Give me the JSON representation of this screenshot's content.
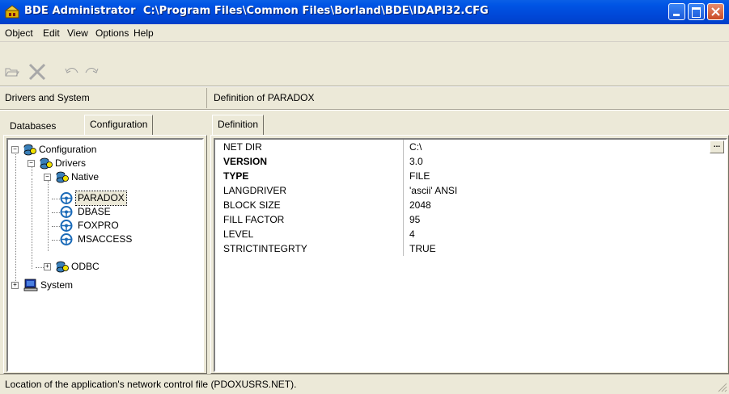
{
  "window": {
    "app": "BDE Administrator",
    "path": "C:\\Program Files\\Common Files\\Borland\\BDE\\IDAPI32.CFG"
  },
  "menu": [
    {
      "label": "Object"
    },
    {
      "label": "Edit"
    },
    {
      "label": "View"
    },
    {
      "label": "Options"
    },
    {
      "label": "Help"
    }
  ],
  "toolbar": {
    "icons": [
      "open-icon",
      "delete-icon",
      "undo-icon",
      "redo-icon"
    ]
  },
  "left_header": "Drivers and System",
  "right_header": "Definition of PARADOX",
  "left_tabs": [
    "Databases",
    "Configuration"
  ],
  "right_tabs": [
    "Definition"
  ],
  "tree": {
    "root": "Configuration",
    "drivers": "Drivers",
    "native": "Native",
    "native_items": [
      "PARADOX",
      "DBASE",
      "FOXPRO",
      "MSACCESS"
    ],
    "odbc": "ODBC",
    "system": "System",
    "selected": "PARADOX"
  },
  "definition": [
    {
      "name": "NET DIR",
      "value": "C:\\",
      "bold": false
    },
    {
      "name": "VERSION",
      "value": "3.0",
      "bold": true
    },
    {
      "name": "TYPE",
      "value": "FILE",
      "bold": true
    },
    {
      "name": "LANGDRIVER",
      "value": "'ascii' ANSI",
      "bold": false
    },
    {
      "name": "BLOCK SIZE",
      "value": "2048",
      "bold": false
    },
    {
      "name": "FILL FACTOR",
      "value": "95",
      "bold": false
    },
    {
      "name": "LEVEL",
      "value": "4",
      "bold": false
    },
    {
      "name": "STRICTINTEGRTY",
      "value": "TRUE",
      "bold": false
    }
  ],
  "ellipsis_label": "...",
  "status": "Location of the application's network control file (PDOXUSRS.NET)."
}
